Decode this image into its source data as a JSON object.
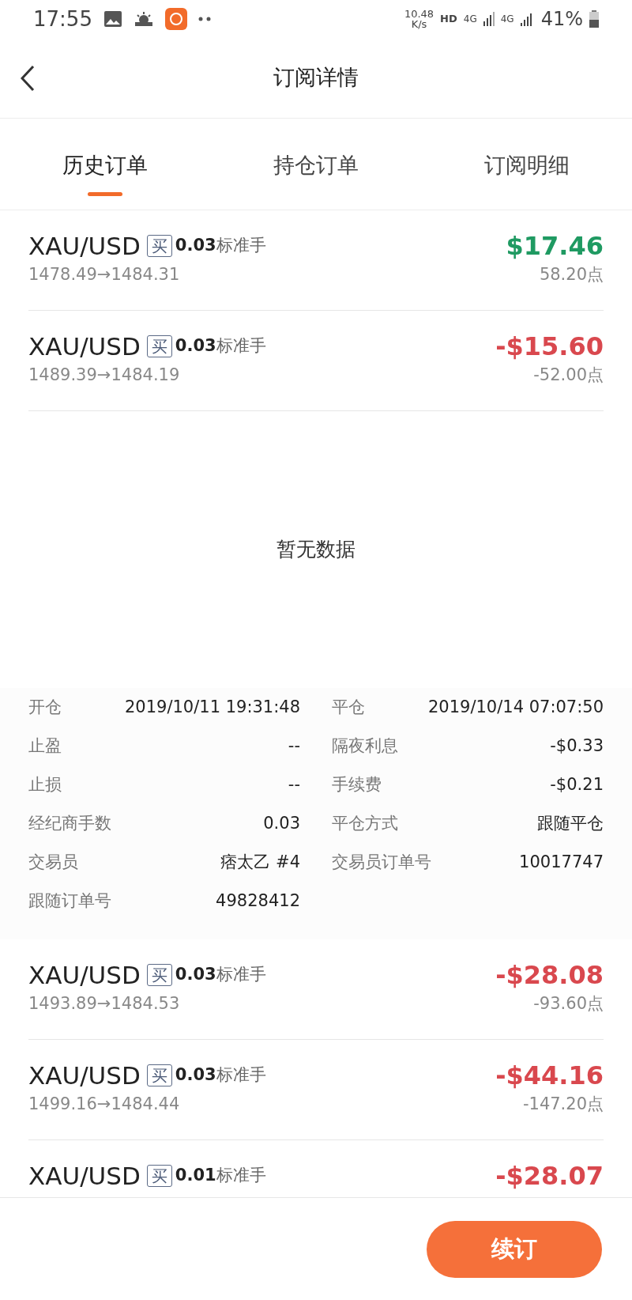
{
  "status_bar": {
    "time": "17:55",
    "speed": "10.48",
    "speed_unit": "K/s",
    "hd": "HD",
    "network_1": "4G",
    "network_2": "4G",
    "battery": "41%"
  },
  "header": {
    "title": "订阅详情"
  },
  "tabs": [
    {
      "label": "历史订单",
      "selected": true
    },
    {
      "label": "持仓订单",
      "selected": false
    },
    {
      "label": "订阅明细",
      "selected": false
    }
  ],
  "orders_top": [
    {
      "symbol": "XAU/USD",
      "side": "买",
      "lots": "0.03",
      "unit": "标准手",
      "prices": "1478.49→1484.31",
      "pnl": "$17.46",
      "points": "58.20点",
      "kind": "gain"
    },
    {
      "symbol": "XAU/USD",
      "side": "买",
      "lots": "0.03",
      "unit": "标准手",
      "prices": "1489.39→1484.19",
      "pnl": "-$15.60",
      "points": "-52.00点",
      "kind": "loss"
    }
  ],
  "empty_message": "暂无数据",
  "details": [
    {
      "label": "开仓",
      "value": "2019/10/11 19:31:48"
    },
    {
      "label": "平仓",
      "value": "2019/10/14 07:07:50"
    },
    {
      "label": "止盈",
      "value": "--"
    },
    {
      "label": "隔夜利息",
      "value": "-$0.33"
    },
    {
      "label": "止损",
      "value": "--"
    },
    {
      "label": "手续费",
      "value": "-$0.21"
    },
    {
      "label": "经纪商手数",
      "value": "0.03"
    },
    {
      "label": "平仓方式",
      "value": "跟随平仓"
    },
    {
      "label": "交易员",
      "value": "痞太乙 #4"
    },
    {
      "label": "交易员订单号",
      "value": "10017747"
    },
    {
      "label": "跟随订单号",
      "value": "49828412"
    }
  ],
  "orders_bottom": [
    {
      "symbol": "XAU/USD",
      "side": "买",
      "lots": "0.03",
      "unit": "标准手",
      "prices": "1493.89→1484.53",
      "pnl": "-$28.08",
      "points": "-93.60点",
      "kind": "loss"
    },
    {
      "symbol": "XAU/USD",
      "side": "买",
      "lots": "0.03",
      "unit": "标准手",
      "prices": "1499.16→1484.44",
      "pnl": "-$44.16",
      "points": "-147.20点",
      "kind": "loss"
    },
    {
      "symbol": "XAU/USD",
      "side": "买",
      "lots": "0.01",
      "unit": "标准手",
      "pnl": "-$28.07",
      "kind": "loss"
    }
  ],
  "renew_button": "续订"
}
